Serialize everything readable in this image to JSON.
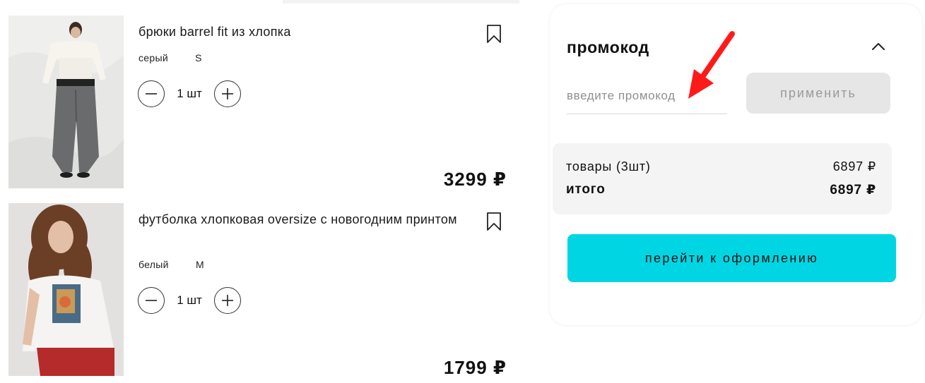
{
  "cart": {
    "items": [
      {
        "title": "брюки barrel fit из хлопка",
        "color": "серый",
        "size": "S",
        "quantity": "1 шт",
        "price": "3299 ₽",
        "photo_icon": "product-photo-trousers"
      },
      {
        "title": "футболка хлопковая oversize с новогодним принтом",
        "color": "белый",
        "size": "M",
        "quantity": "1 шт",
        "price": "1799 ₽",
        "photo_icon": "product-photo-tshirt"
      }
    ]
  },
  "promo": {
    "title": "промокод",
    "placeholder": "введите промокод",
    "value": "",
    "apply_label": "применить"
  },
  "summary": {
    "goods_label": "товары (3шт)",
    "goods_value": "6897 ₽",
    "total_label": "итого",
    "total_value": "6897 ₽"
  },
  "checkout_label": "перейти к оформлению",
  "colors": {
    "accent": "#00d6e3",
    "annotation_arrow": "#ff1a1a",
    "apply_bg": "#e6e6e6",
    "summary_bg": "#f4f4f4"
  }
}
